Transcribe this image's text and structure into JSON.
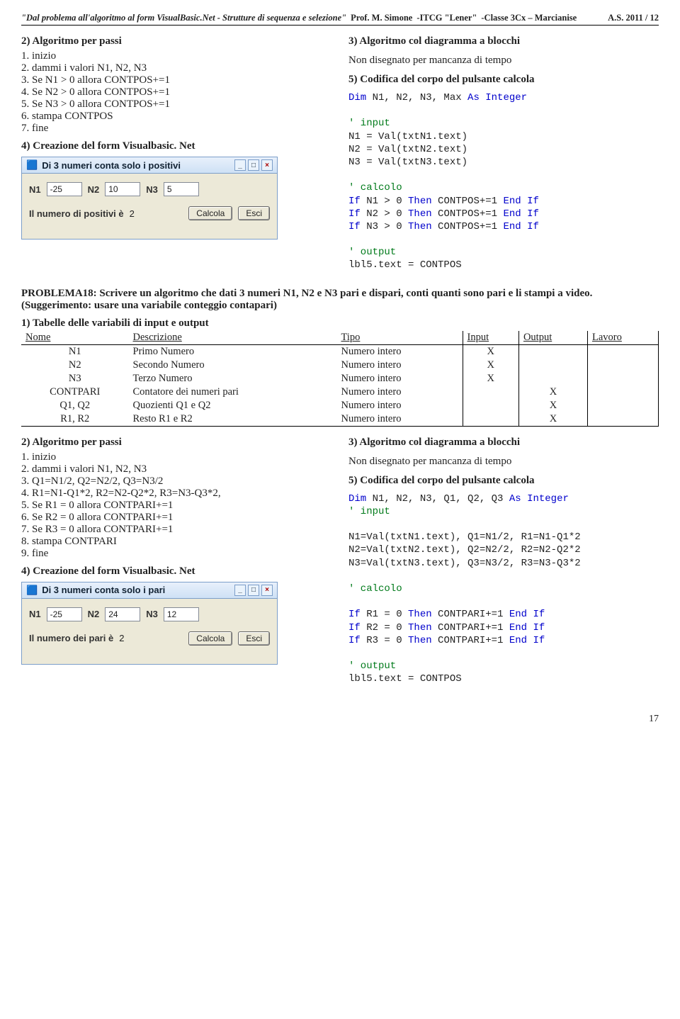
{
  "header": {
    "title_ital": "\"Dal problema all'algoritmo al form VisualBasic.Net - Strutture di sequenza e selezione\"",
    "prof": "Prof. M. Simone",
    "school": " -ITCG \"Lener\"",
    "clazz": " -Classe 3Cx – Marcianise",
    "year": "A.S. 2011 / 12"
  },
  "sec1": {
    "algoPerPassi": "2) Algoritmo per passi",
    "steps": "1. inizio\n2. dammi i valori N1, N2, N3\n3. Se N1 > 0 allora CONTPOS+=1\n4. Se N2 > 0 allora CONTPOS+=1\n5. Se N3 > 0 allora CONTPOS+=1\n6. stampa CONTPOS\n7. fine",
    "formTitle": "4) Creazione del form Visualbasic. Net",
    "winCaption": "Di 3 numeri conta solo i positivi",
    "n1lab": "N1",
    "n2lab": "N2",
    "n3lab": "N3",
    "n1val": "-25",
    "n2val": "10",
    "n3val": "5",
    "resLab": "Il numero di positivi è",
    "resVal": "2",
    "btnCalc": "Calcola",
    "btnEsci": "Esci",
    "algoDiag": "3) Algoritmo col diagramma a blocchi",
    "nonDis": "Non disegnato per mancanza di tempo",
    "codifica": "5) Codifica del corpo del pulsante calcola"
  },
  "code1": {
    "l1a": "Dim",
    "l1b": " N1, N2, N3, Max ",
    "l1c": "As Integer",
    "cmInput": "' input",
    "l2": "N1 = Val(txtN1.text)",
    "l3": "N2 = Val(txtN2.text)",
    "l4": "N3 = Val(txtN3.text)",
    "cmCalc": "' calcolo",
    "if1a": "If",
    "if1b": " N1 > 0 ",
    "if1c": "Then",
    "if1d": " CONTPOS+=1 ",
    "if1e": "End If",
    "if2b": " N2 > 0 ",
    "if3b": " N3 > 0 ",
    "cmOut": "' output",
    "last": "lbl5.text = CONTPOS"
  },
  "problema18": "PROBLEMA18: Scrivere un algoritmo che dati 3 numeri N1, N2 e N3 pari e dispari, conti quanti sono pari e li stampi a video. (Suggerimento: usare una variabile conteggio contapari)",
  "tabTitle": "1) Tabelle delle variabili di input e output",
  "tab": {
    "hName": "Nome",
    "hDesc": "Descrizione",
    "hTipo": "Tipo",
    "hInput": "Input",
    "hOutput": "Output",
    "hLavoro": "Lavoro",
    "r1n": "N1",
    "r1d": "Primo Numero",
    "r1t": "Numero intero",
    "r1i": "X",
    "r2n": "N2",
    "r2d": "Secondo Numero",
    "r2t": "Numero intero",
    "r2i": "X",
    "r3n": "N3",
    "r3d": "Terzo Numero",
    "r3t": "Numero intero",
    "r3i": "X",
    "r4n": "CONTPARI",
    "r4d": "Contatore dei numeri pari",
    "r4t": "Numero intero",
    "r4o": "X",
    "r5n": "Q1, Q2",
    "r5d": "Quozienti Q1 e Q2",
    "r5t": "Numero intero",
    "r5o": "X",
    "r6n": "R1, R2",
    "r6d": "Resto R1 e R2",
    "r6t": "Numero intero",
    "r6o": "X"
  },
  "sec2": {
    "steps": "1. inizio\n2. dammi i valori N1, N2, N3\n3. Q1=N1/2, Q2=N2/2, Q3=N3/2\n4. R1=N1-Q1*2, R2=N2-Q2*2, R3=N3-Q3*2,\n5. Se R1 = 0 allora CONTPARI+=1\n6. Se R2 = 0 allora CONTPARI+=1\n7. Se R3 = 0 allora CONTPARI+=1\n8. stampa CONTPARI\n9. fine",
    "winCaption": "Di 3 numeri conta solo i pari",
    "n1val": "-25",
    "n2val": "24",
    "n3val": "12",
    "resLab": "Il numero dei pari è",
    "resVal": "2"
  },
  "code2": {
    "l1a": "Dim",
    "l1b": " N1, N2, N3, Q1, Q2, Q3 ",
    "l1c": "As Integer",
    "l2": "N1=Val(txtN1.text), Q1=N1/2, R1=N1-Q1*2",
    "l3": "N2=Val(txtN2.text), Q2=N2/2, R2=N2-Q2*2",
    "l4": "N3=Val(txtN3.text), Q3=N3/2, R3=N3-Q3*2",
    "if1b": " R1 = 0 ",
    "ifd": " CONTPARI+=1 ",
    "if2b": " R2 = 0 ",
    "if3b": " R3 = 0 ",
    "last": "lbl5.text = CONTPOS"
  },
  "pagenum": "17"
}
